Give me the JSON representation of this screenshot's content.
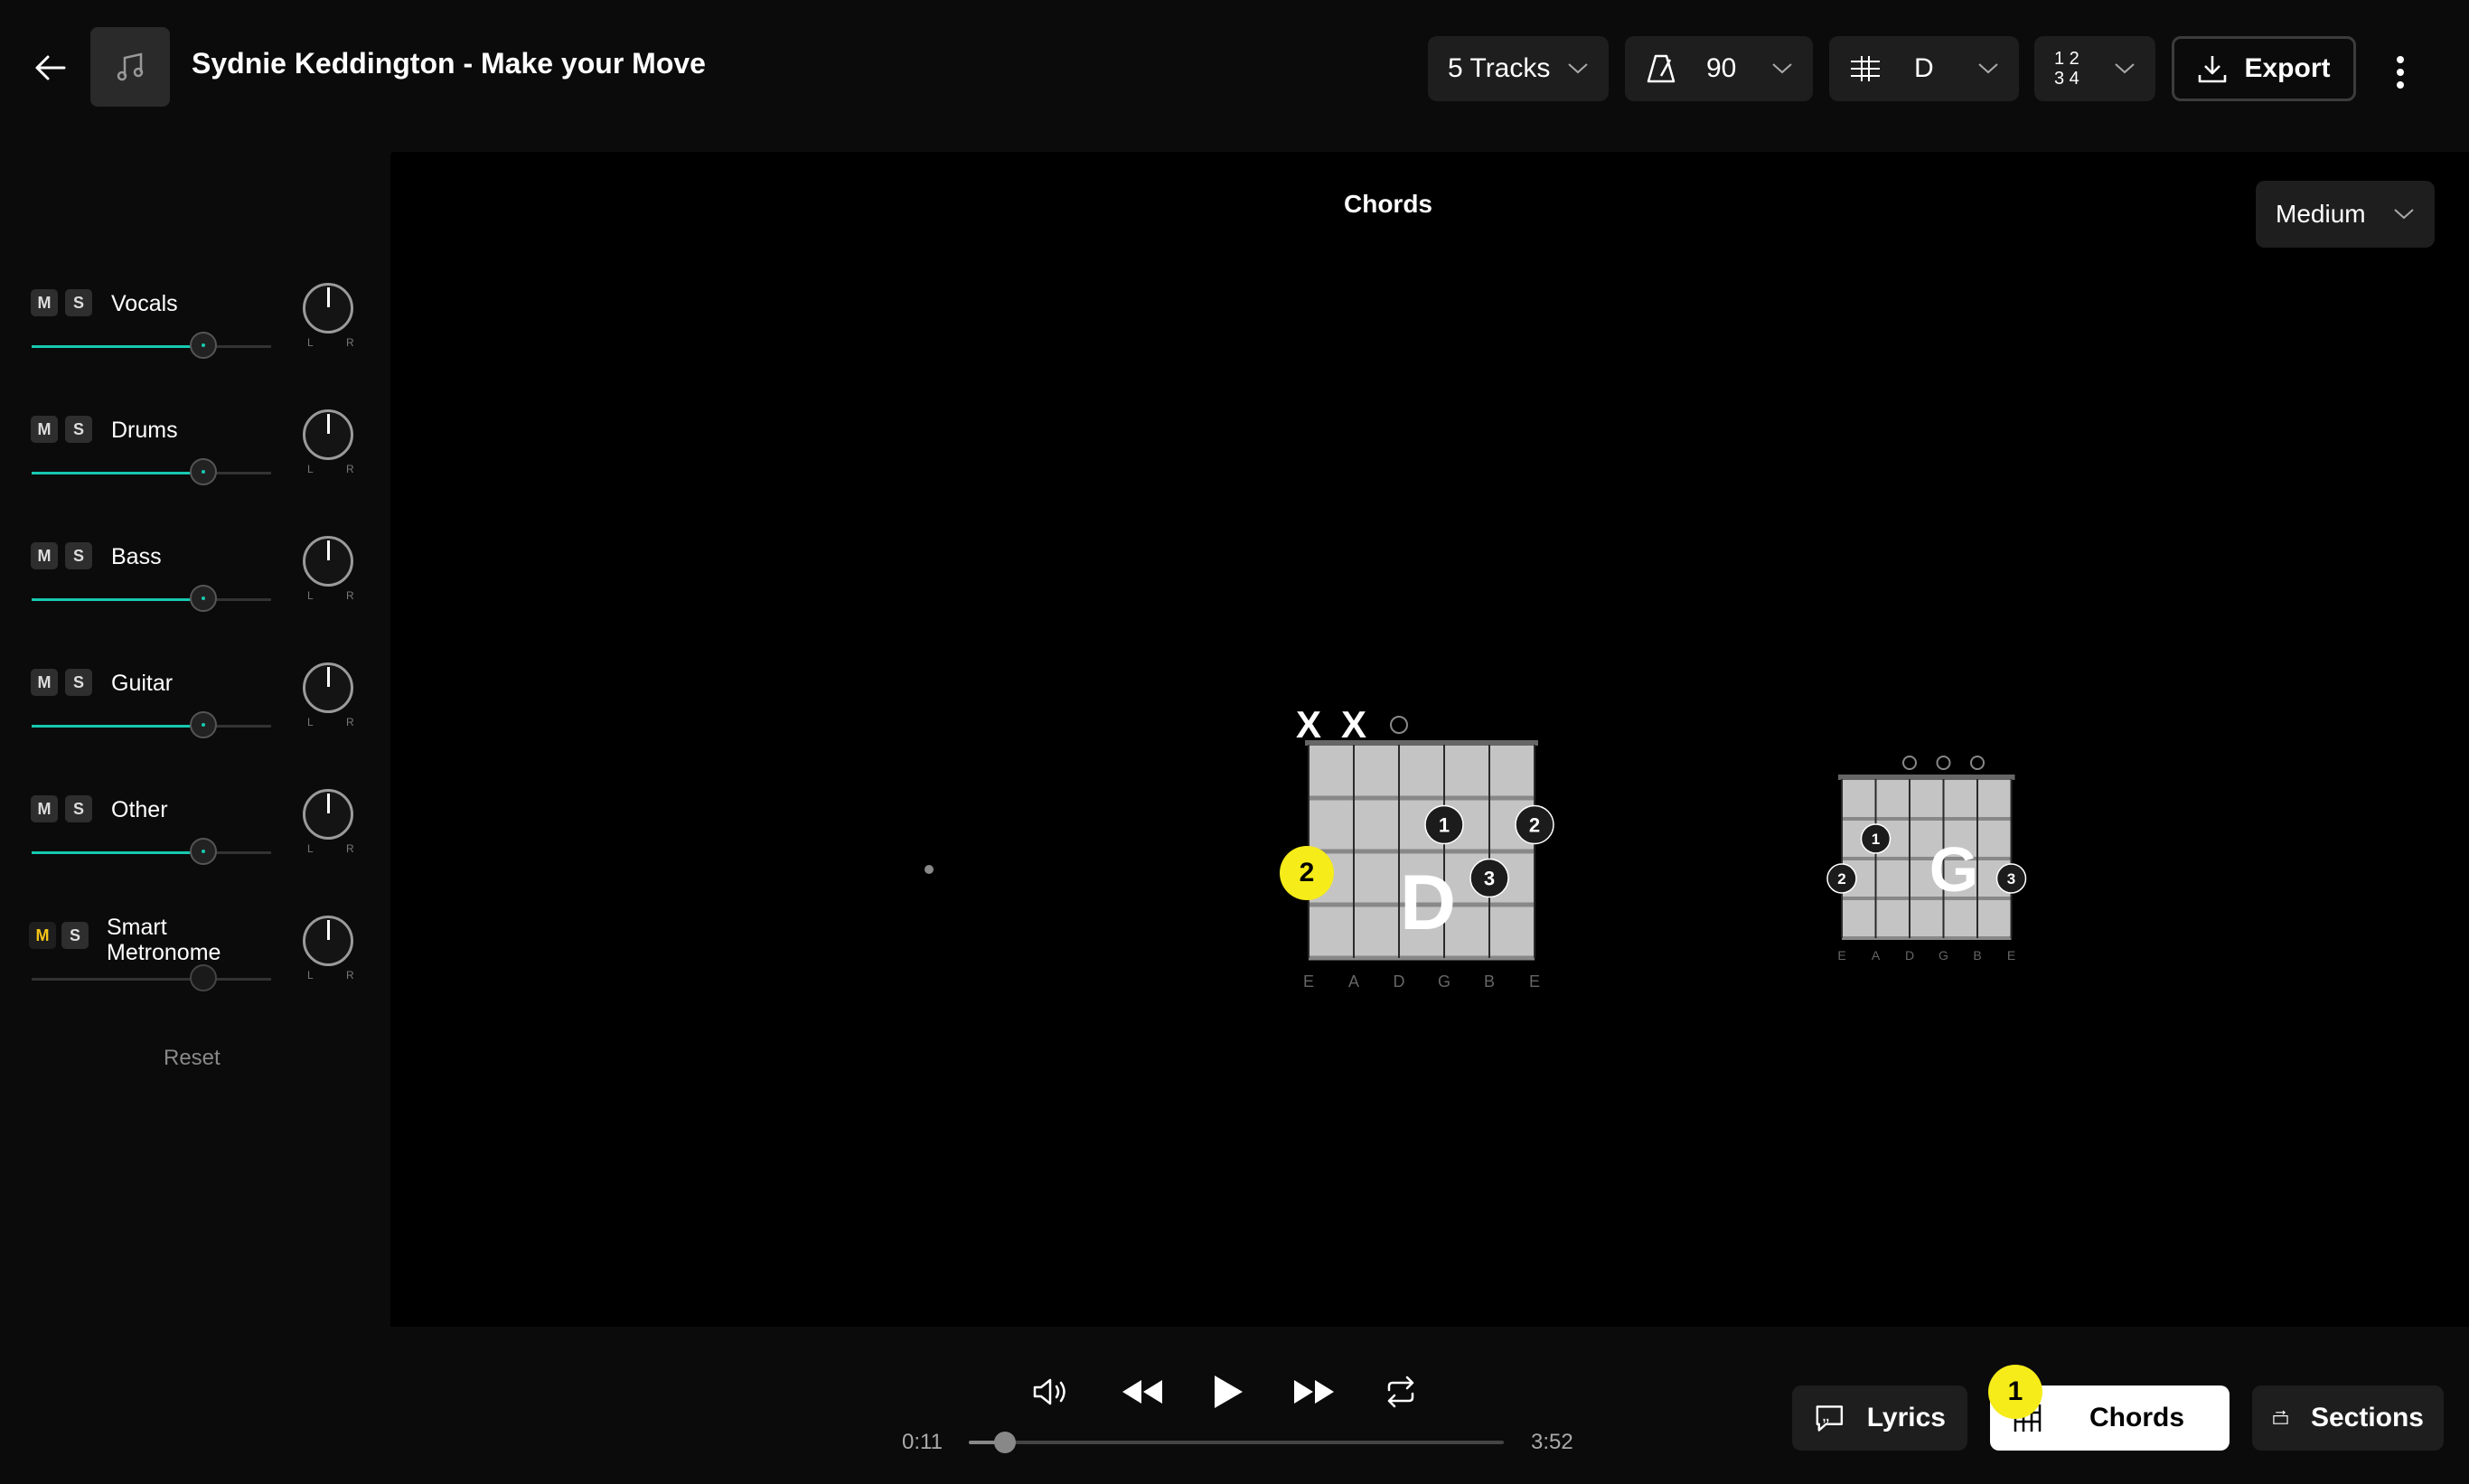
{
  "header": {
    "title": "Sydnie Keddington - Make your Move",
    "tracks_label": "5 Tracks",
    "tempo": "90",
    "key": "D",
    "time_signature_top": "1 2",
    "time_signature_bottom": "3 4",
    "export_label": "Export"
  },
  "sidebar": {
    "pan_left": "L",
    "pan_right": "R",
    "mute_label": "M",
    "solo_label": "S",
    "tracks": [
      {
        "name": "Vocals",
        "volume": 0.72,
        "muted": false
      },
      {
        "name": "Drums",
        "volume": 0.72,
        "muted": false
      },
      {
        "name": "Bass",
        "volume": 0.72,
        "muted": false
      },
      {
        "name": "Guitar",
        "volume": 0.72,
        "muted": false
      },
      {
        "name": "Other",
        "volume": 0.72,
        "muted": false
      },
      {
        "name_line1": "Smart",
        "name_line2": "Metronome",
        "volume": 0.72,
        "muted": true
      }
    ],
    "reset_label": "Reset"
  },
  "main": {
    "title": "Chords",
    "difficulty": "Medium",
    "string_labels": [
      "E",
      "A",
      "D",
      "G",
      "B",
      "E"
    ],
    "chords": [
      {
        "name": "D",
        "markers": [
          "X",
          "X",
          "○",
          "",
          "",
          ""
        ],
        "fingers": [
          {
            "string": 4,
            "fret": 2,
            "label": "1"
          },
          {
            "string": 6,
            "fret": 2,
            "label": "2"
          },
          {
            "string": 5,
            "fret": 3,
            "label": "3"
          }
        ]
      },
      {
        "name": "G",
        "markers": [
          "",
          "",
          "○",
          "○",
          "○",
          ""
        ],
        "fingers": [
          {
            "string": 2,
            "fret": 2,
            "label": "1"
          },
          {
            "string": 1,
            "fret": 3,
            "label": "2"
          },
          {
            "string": 6,
            "fret": 3,
            "label": "3"
          }
        ]
      }
    ],
    "badge_2": "2"
  },
  "transport": {
    "current_time": "0:11",
    "total_time": "3:52",
    "progress": 0.05
  },
  "views": {
    "lyrics_label": "Lyrics",
    "chords_label": "Chords",
    "sections_label": "Sections",
    "badge_1": "1"
  },
  "colors": {
    "accent": "#16c9b0",
    "badge": "#f5ec1a",
    "muted_active": "#f5c518"
  }
}
